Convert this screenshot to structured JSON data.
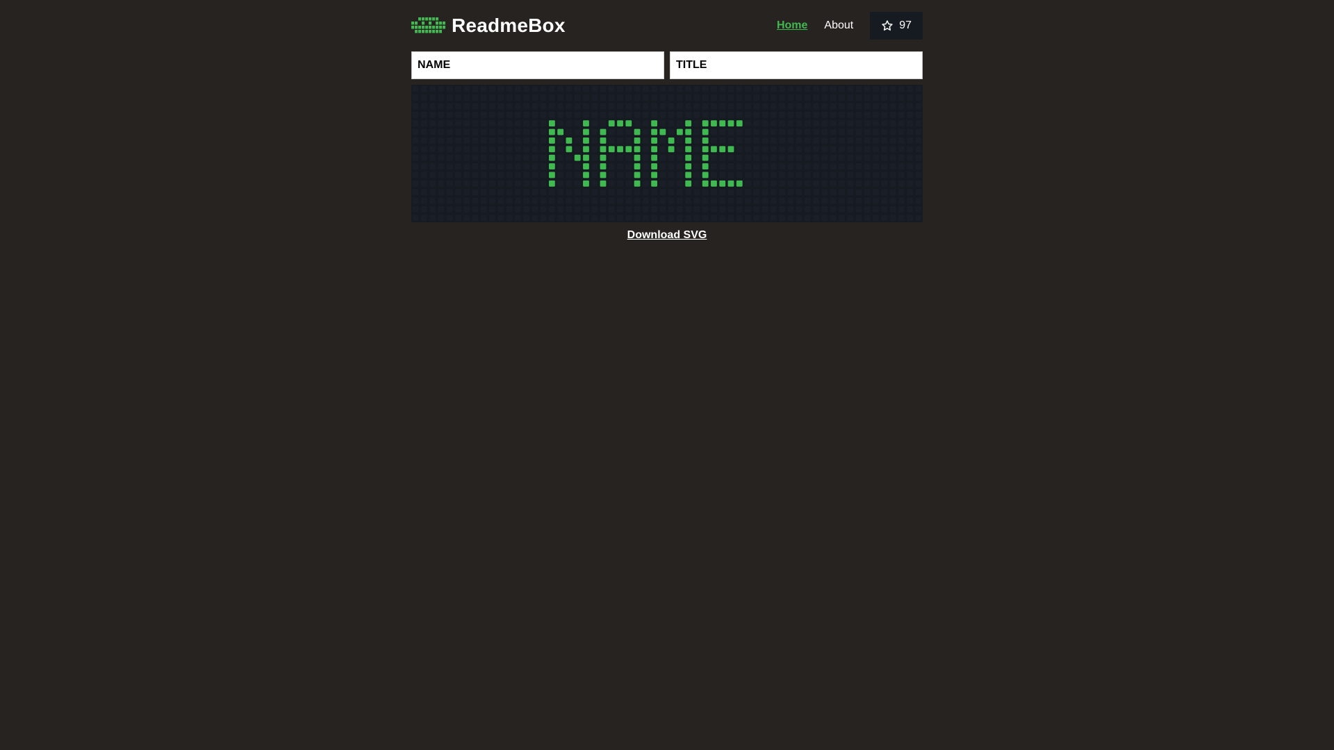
{
  "brand": {
    "name": "ReadmeBox",
    "logo_icon": "dot-matrix-logo-icon",
    "color": "#3fb950"
  },
  "nav": {
    "items": [
      {
        "label": "Home",
        "active": true
      },
      {
        "label": "About",
        "active": false
      }
    ]
  },
  "star_button": {
    "icon": "star-icon",
    "count": "97"
  },
  "form": {
    "name_placeholder": "NAME",
    "title_placeholder": "TITLE"
  },
  "display": {
    "text": "NAME",
    "on_color": "#3fb950",
    "off_color": "#1a1f27",
    "background": "#161b22"
  },
  "download": {
    "label": "Download SVG"
  }
}
